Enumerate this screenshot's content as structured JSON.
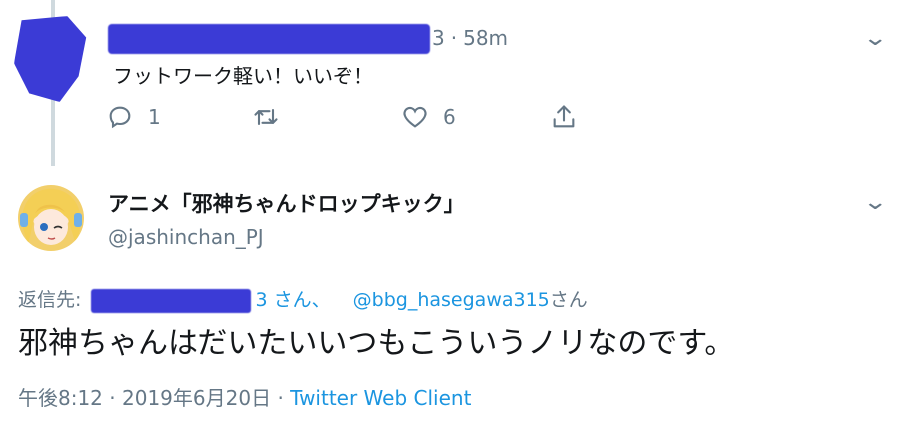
{
  "tweet1": {
    "time": "58m",
    "dot": "·",
    "visible_name_fragment": "3",
    "text": "フットワーク軽い！いいぞ！",
    "reply_count": "1",
    "retweet_count": "",
    "like_count": "6",
    "icons": [
      "reply-icon",
      "retweet-icon",
      "like-icon",
      "share-icon",
      "chevron-down-icon"
    ]
  },
  "tweet2": {
    "display_name": "アニメ「邪神ちゃんドロップキック」",
    "handle": "@jashinchan_PJ",
    "reply_prefix": "返信先:",
    "reply_fragment": "3",
    "reply_mid": "さん、",
    "reply_target": "@bbg_hasegawa315",
    "reply_suffix": "さん",
    "text": "邪神ちゃんはだいたいいつもこういうノリなのです。",
    "time": "午後8:12",
    "date": "2019年6月20日",
    "dot": "·",
    "client": "Twitter Web Client"
  },
  "colors": {
    "accent": "#1b95e0",
    "muted": "#657786",
    "redaction": "#3b3bd6",
    "thread_line": "#cfd9de"
  }
}
